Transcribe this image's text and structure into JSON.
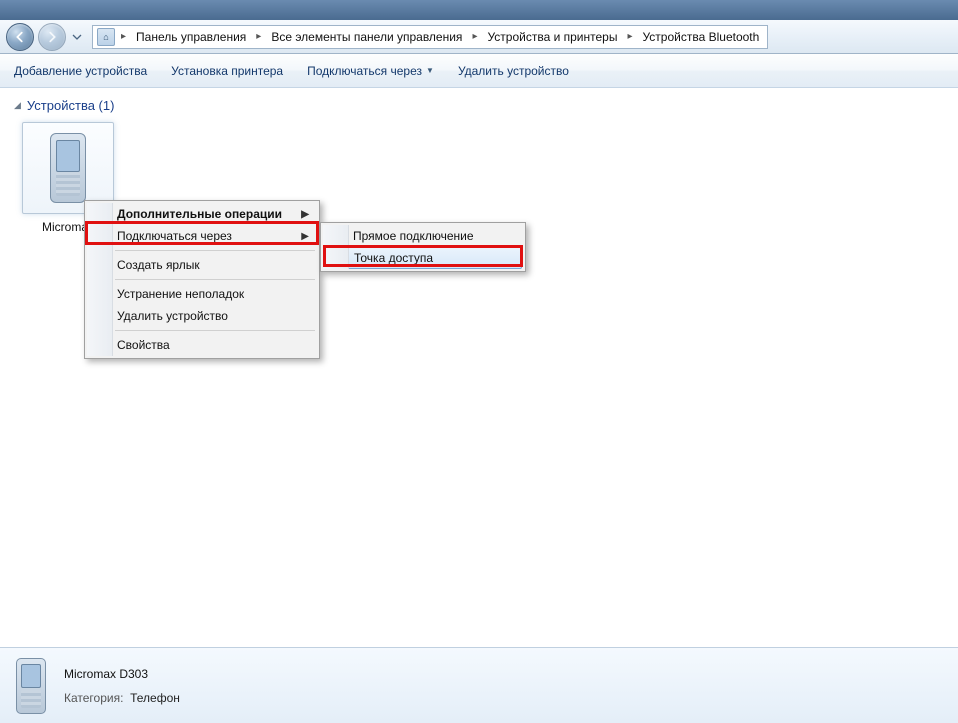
{
  "breadcrumb": {
    "seg0": "Панель управления",
    "seg1": "Все элементы панели управления",
    "seg2": "Устройства и принтеры",
    "seg3": "Устройства Bluetooth"
  },
  "toolbar": {
    "add_device": "Добавление устройства",
    "add_printer": "Установка принтера",
    "connect_via": "Подключаться через",
    "remove_device": "Удалить устройство"
  },
  "group": {
    "title": "Устройства (1)"
  },
  "device": {
    "label": "Micromax"
  },
  "context_menu": {
    "extra_ops": "Дополнительные операции",
    "connect_via": "Подключаться через",
    "create_shortcut": "Создать ярлык",
    "troubleshoot": "Устранение неполадок",
    "remove_device": "Удалить устройство",
    "properties": "Свойства"
  },
  "submenu": {
    "direct": "Прямое подключение",
    "access_point": "Точка доступа"
  },
  "details": {
    "name": "Micromax D303",
    "category_label": "Категория:",
    "category_value": "Телефон"
  }
}
